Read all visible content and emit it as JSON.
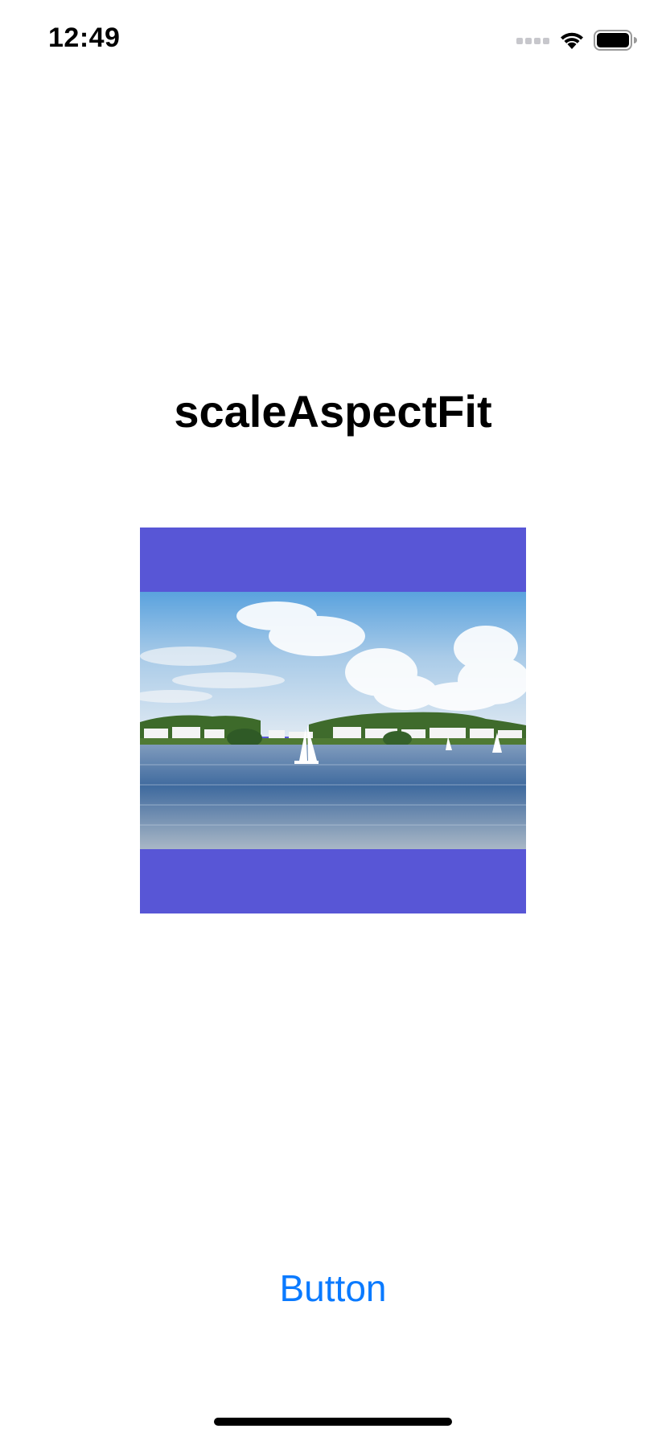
{
  "status_bar": {
    "time": "12:49",
    "icons": [
      "signal-icon",
      "wifi-icon",
      "battery-icon"
    ]
  },
  "title": "scaleAspectFit",
  "image_view": {
    "background_color": "#5856d6",
    "content": "lake-landscape-photo"
  },
  "button": {
    "label": "Button",
    "color": "#0a7aff"
  }
}
